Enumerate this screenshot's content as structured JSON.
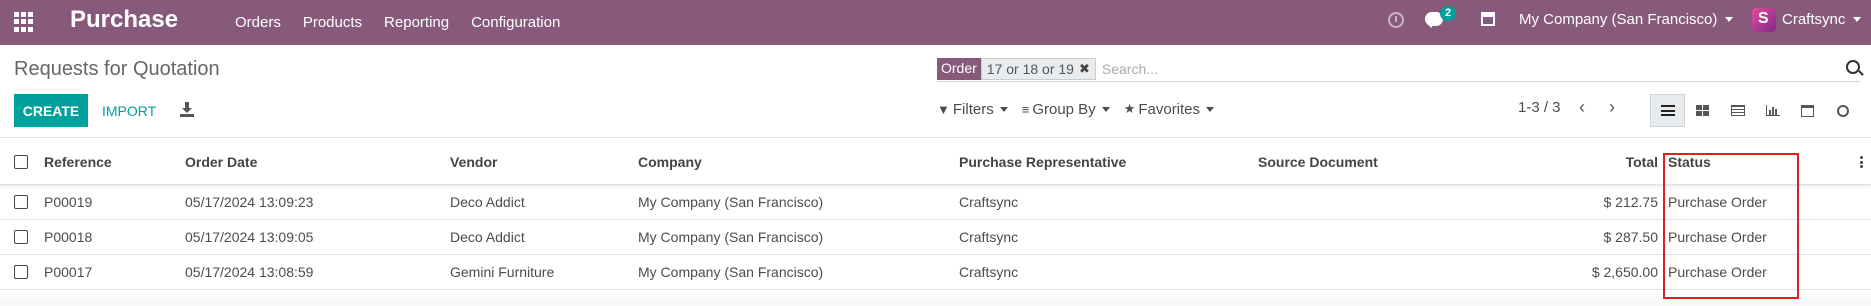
{
  "navbar": {
    "app_name": "Purchase",
    "menu": [
      "Orders",
      "Products",
      "Reporting",
      "Configuration"
    ],
    "messages_badge": "2",
    "company": "My Company (San Francisco)",
    "user": "Craftsync",
    "color": "#875a7b"
  },
  "page": {
    "breadcrumb": "Requests for Quotation",
    "create_label": "CREATE",
    "import_label": "IMPORT"
  },
  "search": {
    "facet_label": "Order",
    "facet_value": "17 or 18 or 19",
    "facet_remove": "✖",
    "placeholder": "Search..."
  },
  "filters": {
    "filters_label": "Filters",
    "groupby_label": "Group By",
    "favorites_label": "Favorites"
  },
  "pager": {
    "value": "1-3 / 3",
    "prev": "‹",
    "next": "›"
  },
  "views": [
    "list-view",
    "kanban-view",
    "pivot-view",
    "graph-view",
    "calendar-view",
    "activity-view"
  ],
  "table": {
    "columns": {
      "reference": "Reference",
      "order_date": "Order Date",
      "vendor": "Vendor",
      "company": "Company",
      "rep": "Purchase Representative",
      "source": "Source Document",
      "total": "Total",
      "status": "Status"
    },
    "rows": [
      {
        "reference": "P00019",
        "order_date": "05/17/2024 13:09:23",
        "vendor": "Deco Addict",
        "company": "My Company (San Francisco)",
        "rep": "Craftsync",
        "source": "",
        "total": "$ 212.75",
        "status": "Purchase Order"
      },
      {
        "reference": "P00018",
        "order_date": "05/17/2024 13:09:05",
        "vendor": "Deco Addict",
        "company": "My Company (San Francisco)",
        "rep": "Craftsync",
        "source": "",
        "total": "$ 287.50",
        "status": "Purchase Order"
      },
      {
        "reference": "P00017",
        "order_date": "05/17/2024 13:08:59",
        "vendor": "Gemini Furniture",
        "company": "My Company (San Francisco)",
        "rep": "Craftsync",
        "source": "",
        "total": "$ 2,650.00",
        "status": "Purchase Order"
      }
    ]
  },
  "accent_color": "#00a09d",
  "highlight_color": "#e02020"
}
